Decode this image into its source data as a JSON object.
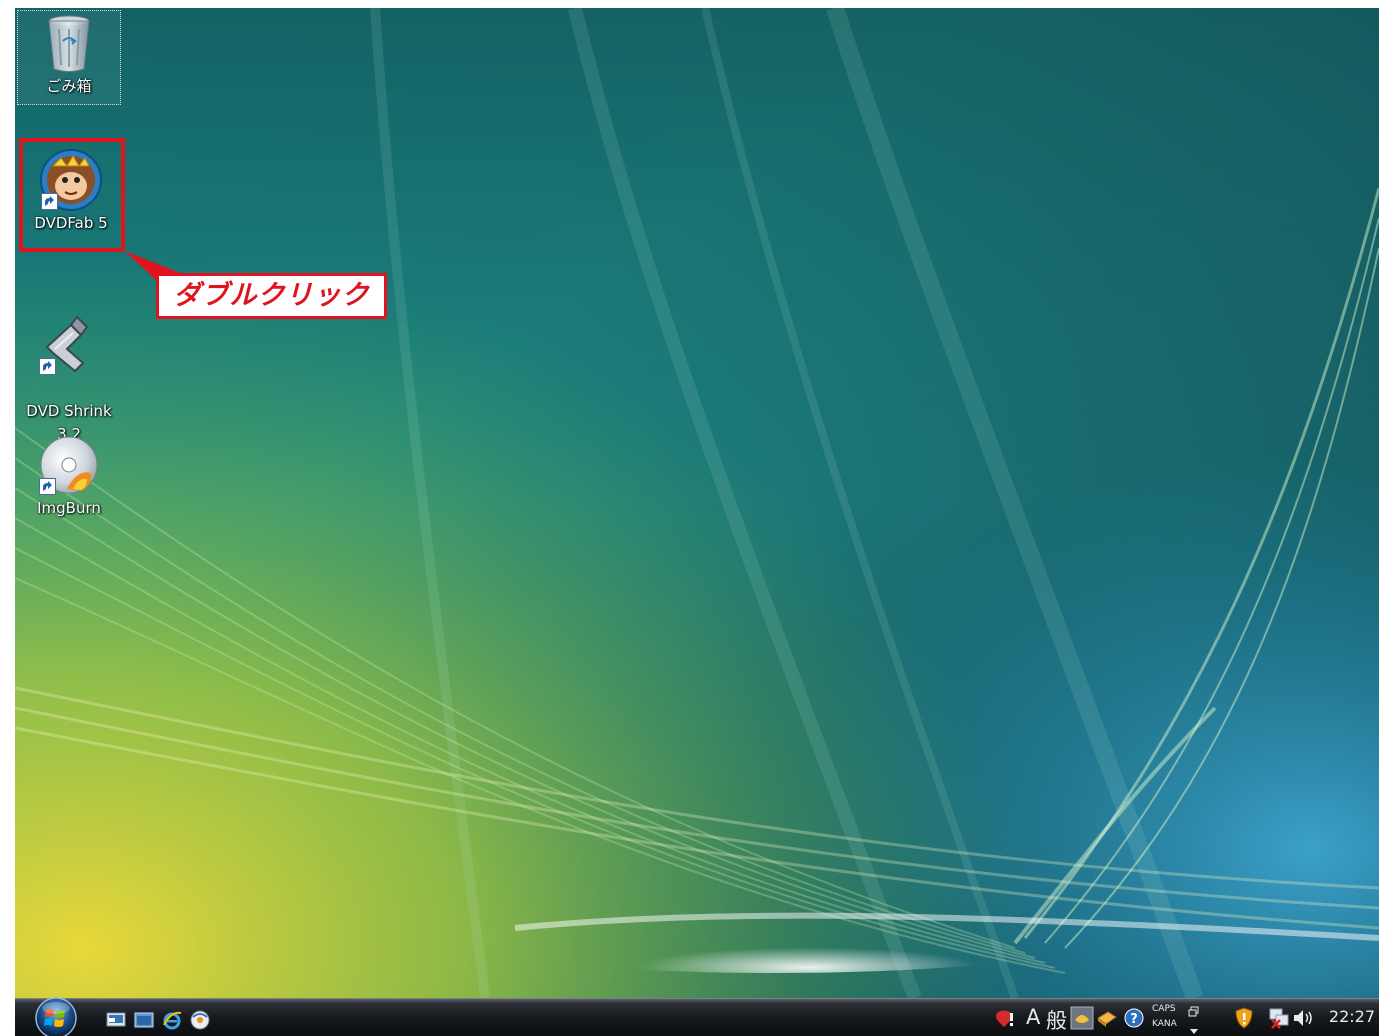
{
  "desktop": {
    "icons": [
      {
        "label": "ごみ箱"
      },
      {
        "label": "DVDFab 5"
      },
      {
        "label": "DVD Shrink\n3.2"
      },
      {
        "label": "ImgBurn"
      }
    ]
  },
  "annotation": {
    "callout_text": "ダブルクリック",
    "color": "#e0141e"
  },
  "taskbar": {
    "start_icon": "windows-orb-icon",
    "quick_launch": [
      "show-desktop-icon",
      "switch-windows-icon",
      "internet-explorer-icon",
      "media-player-icon"
    ],
    "tray": {
      "ime_mode": "A",
      "ime_conversion": "般",
      "caps": "CAPS",
      "kana": "KANA",
      "clock": "22:27"
    }
  }
}
